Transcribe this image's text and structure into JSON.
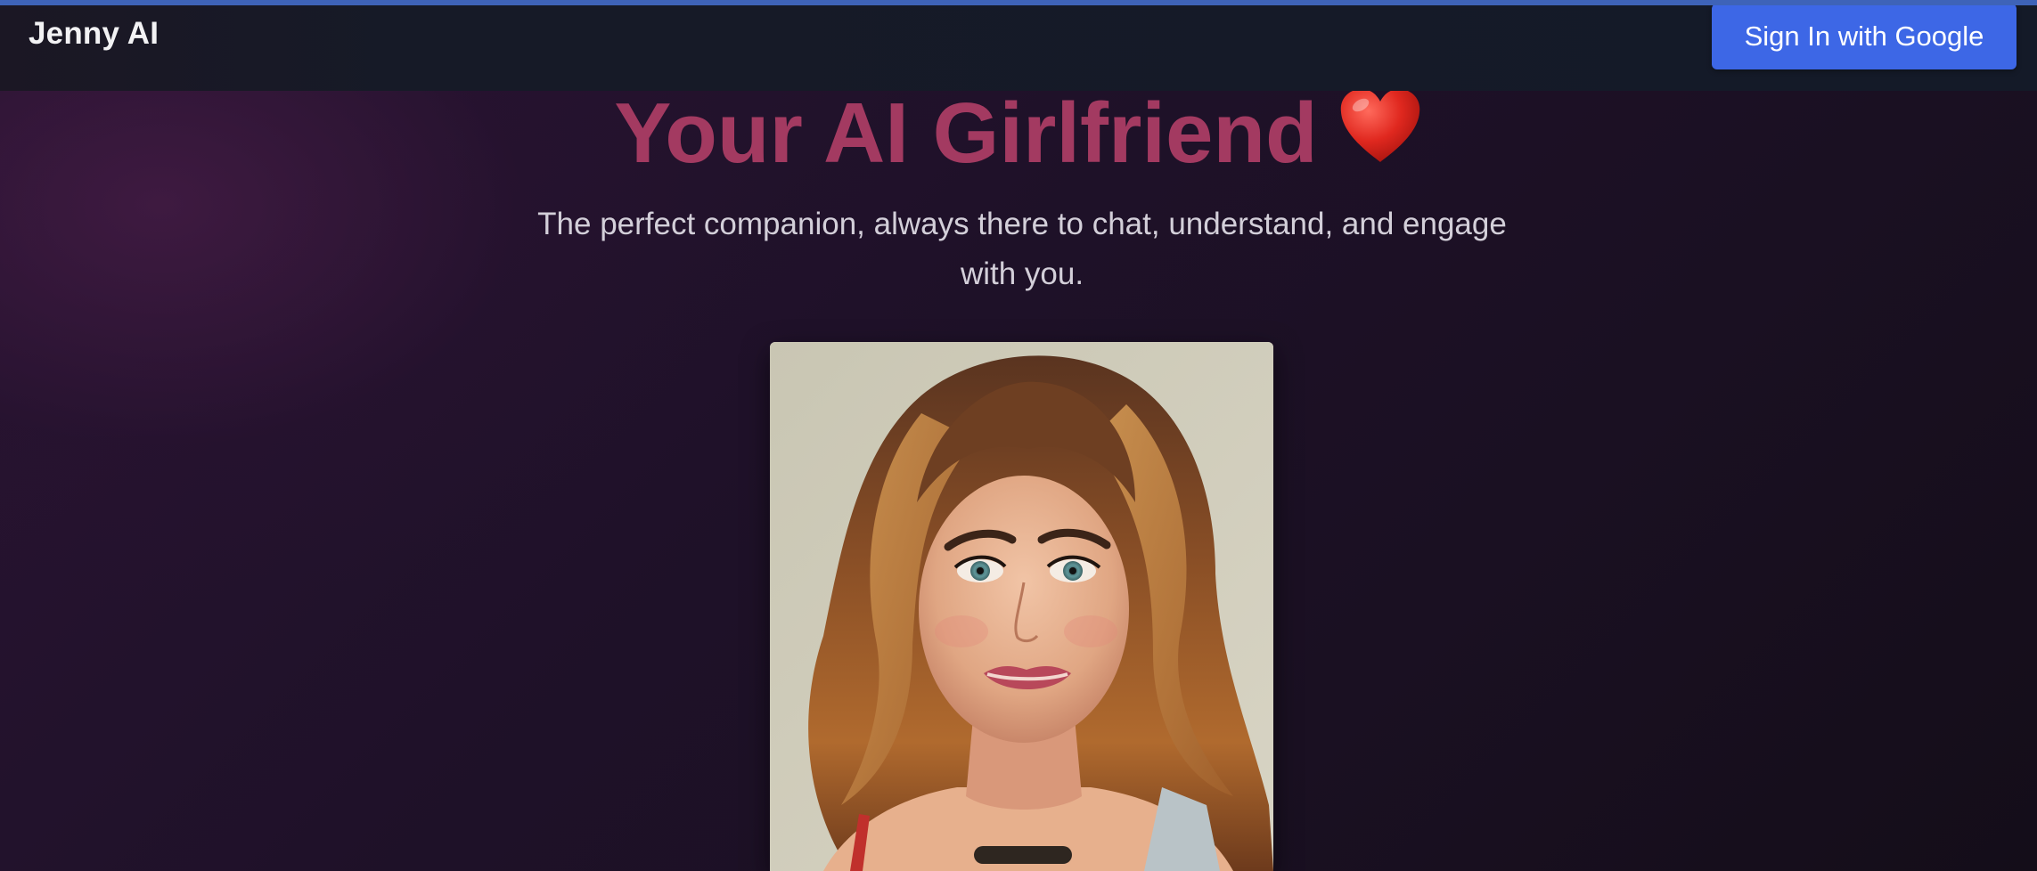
{
  "header": {
    "brand": "Jenny AI",
    "signin_label": "Sign In with Google"
  },
  "hero": {
    "title": "Your AI Girlfriend",
    "title_icon": "red-heart-icon",
    "subtitle": "The perfect companion, always there to chat, understand, and engage with you."
  },
  "portrait": {
    "alt": "portrait of a smiling woman with long wavy auburn hair and blue-green eyes"
  },
  "colors": {
    "accent_bar": "#3e63b8",
    "button": "#3d67e6",
    "title": "#a33a61",
    "background": "#1f1129"
  }
}
